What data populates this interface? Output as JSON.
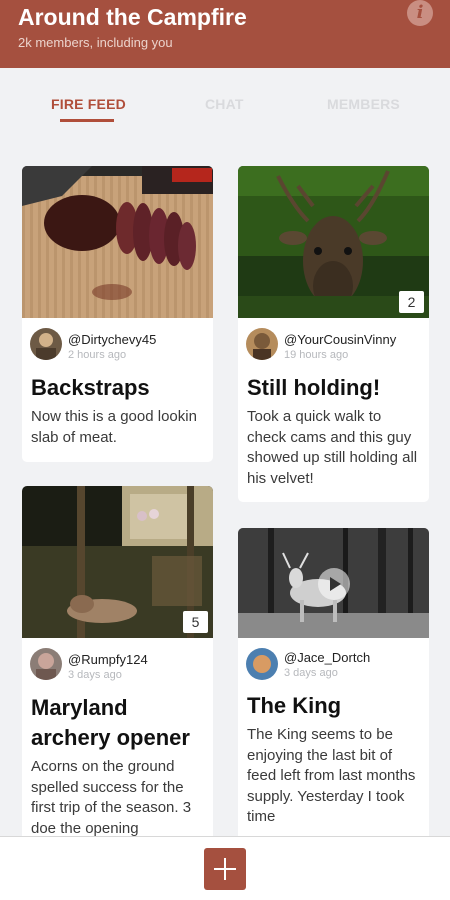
{
  "header": {
    "title": "Around the Campfire",
    "subtitle": "2k members, including you",
    "info_icon": "info-icon"
  },
  "tabs": [
    {
      "label": "FIRE FEED",
      "active": true
    },
    {
      "label": "CHAT",
      "active": false
    },
    {
      "label": "MEMBERS",
      "active": false
    }
  ],
  "posts": [
    {
      "handle": "@Dirtychevy45",
      "time": "2 hours ago",
      "title": "Backstraps",
      "body": "Now this is a good lookin slab of meat.",
      "photo_count": ""
    },
    {
      "handle": "@YourCousinVinny",
      "time": "19 hours ago",
      "title": "Still holding!",
      "body": "Took a quick walk to check cams and this guy showed up still holding all his velvet!",
      "photo_count": "2"
    },
    {
      "handle": "@Rumpfy124",
      "time": "3 days ago",
      "title": "Maryland archery opener",
      "body": "Acorns on the ground spelled success for the first trip of the season. 3 doe the opening",
      "photo_count": "5"
    },
    {
      "handle": "@Jace_Dortch",
      "time": "3 days ago",
      "title": "The King",
      "body": "The King seems to be enjoying the last bit of feed left from last months supply. Yesterday I took time",
      "photo_count": "",
      "video": true
    }
  ],
  "colors": {
    "brand": "#a5503f",
    "active_tab": "#b04e3a"
  },
  "fab": {
    "icon": "plus-icon"
  }
}
